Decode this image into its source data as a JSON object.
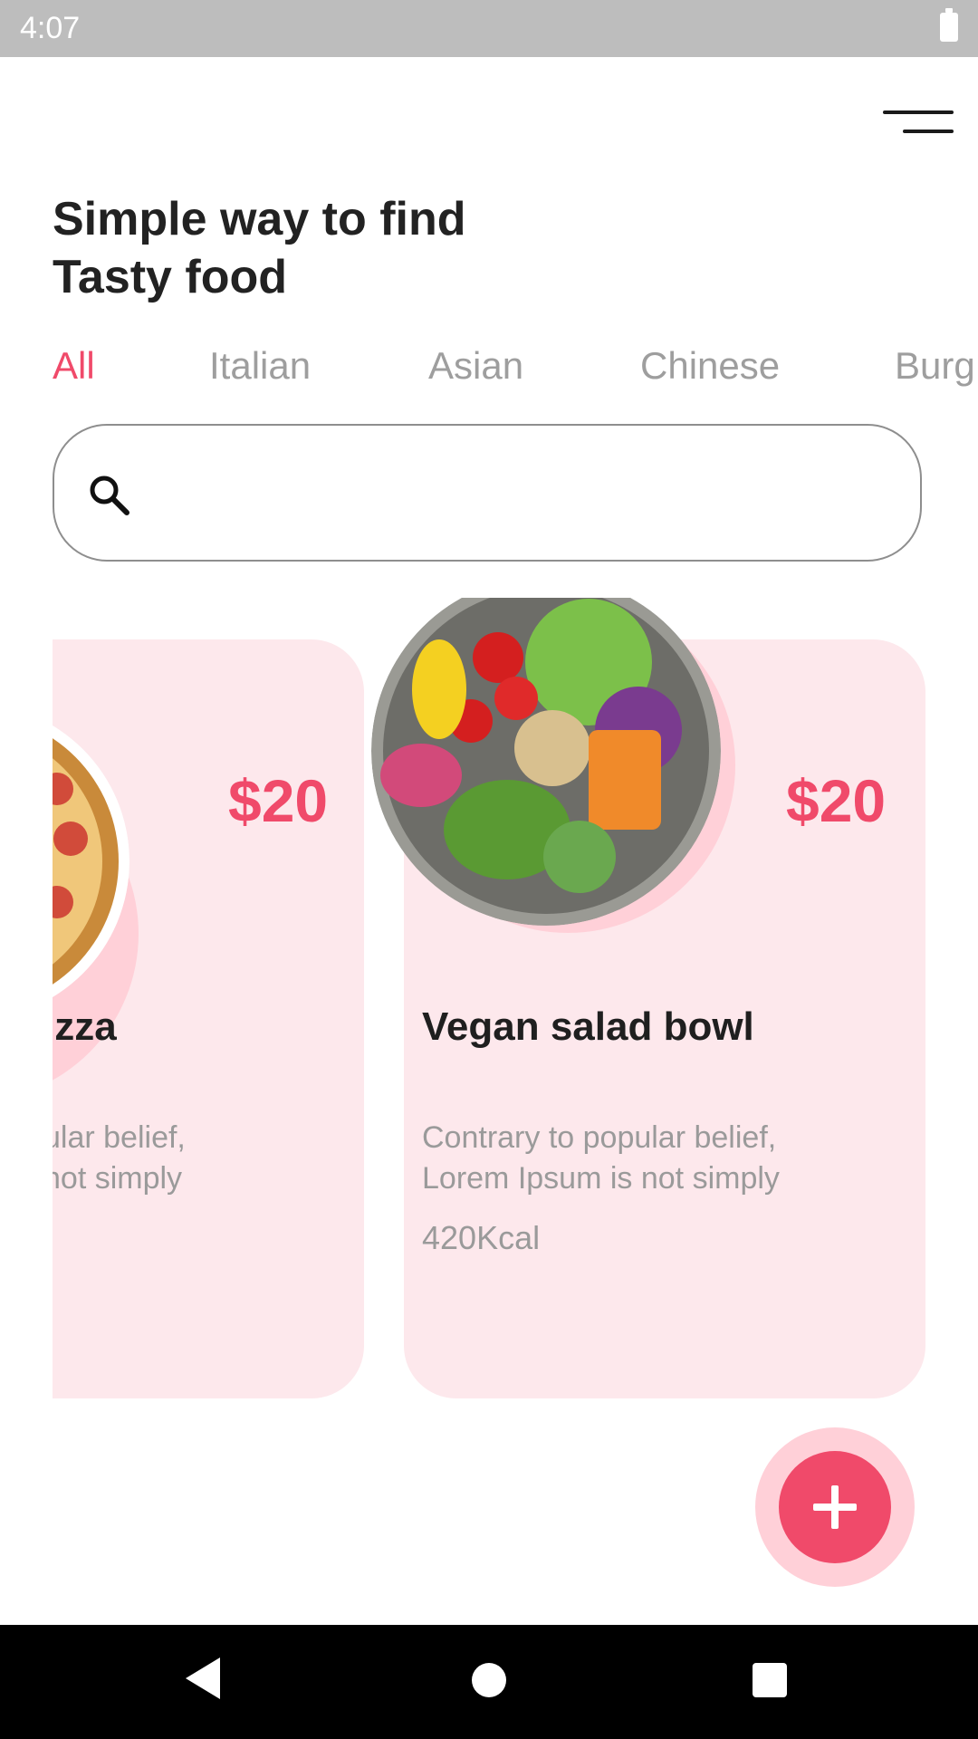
{
  "status_bar": {
    "time": "4:07"
  },
  "headline": {
    "line1": "Simple way to find",
    "line2": "Tasty food"
  },
  "tabs": [
    {
      "label": "All",
      "active": true
    },
    {
      "label": "Italian",
      "active": false
    },
    {
      "label": "Asian",
      "active": false
    },
    {
      "label": "Chinese",
      "active": false
    },
    {
      "label": "Burg",
      "active": false
    }
  ],
  "search": {
    "placeholder": "",
    "value": ""
  },
  "cards": [
    {
      "name": "izza",
      "price": "$20",
      "desc_line1": "ular belief,",
      "desc_line2": "not simply",
      "kcal": ""
    },
    {
      "name": "Vegan salad bowl",
      "price": "$20",
      "desc_line1": "Contrary to popular belief,",
      "desc_line2": "Lorem Ipsum is not simply",
      "kcal": "420Kcal"
    }
  ],
  "colors": {
    "accent": "#f04a6a",
    "card_bg": "#fde8ec",
    "ring": "#ffd0d8"
  },
  "icons": {
    "menu": "menu-icon",
    "search": "search-icon",
    "fab": "plus-icon"
  }
}
